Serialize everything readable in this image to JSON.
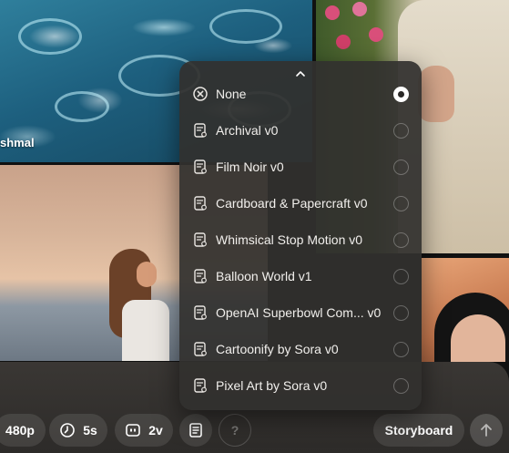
{
  "gallery": {
    "pool_caption": "shmal"
  },
  "preset_menu": {
    "options": [
      {
        "label": "None",
        "icon": "clear-circle-icon",
        "selected": true
      },
      {
        "label": "Archival v0",
        "icon": "preset-icon",
        "selected": false
      },
      {
        "label": "Film Noir v0",
        "icon": "preset-icon",
        "selected": false
      },
      {
        "label": "Cardboard & Papercraft v0",
        "icon": "preset-icon",
        "selected": false
      },
      {
        "label": "Whimsical Stop Motion v0",
        "icon": "preset-icon",
        "selected": false
      },
      {
        "label": "Balloon World v1",
        "icon": "preset-icon",
        "selected": false
      },
      {
        "label": "OpenAI Superbowl Com... v0",
        "icon": "preset-icon",
        "selected": false
      },
      {
        "label": "Cartoonify by Sora v0",
        "icon": "preset-icon",
        "selected": false
      },
      {
        "label": "Pixel Art by Sora v0",
        "icon": "preset-icon",
        "selected": false
      }
    ]
  },
  "toolbar": {
    "resolution": "480p",
    "duration": "5s",
    "variations": "2v",
    "help": "?",
    "storyboard": "Storyboard"
  }
}
